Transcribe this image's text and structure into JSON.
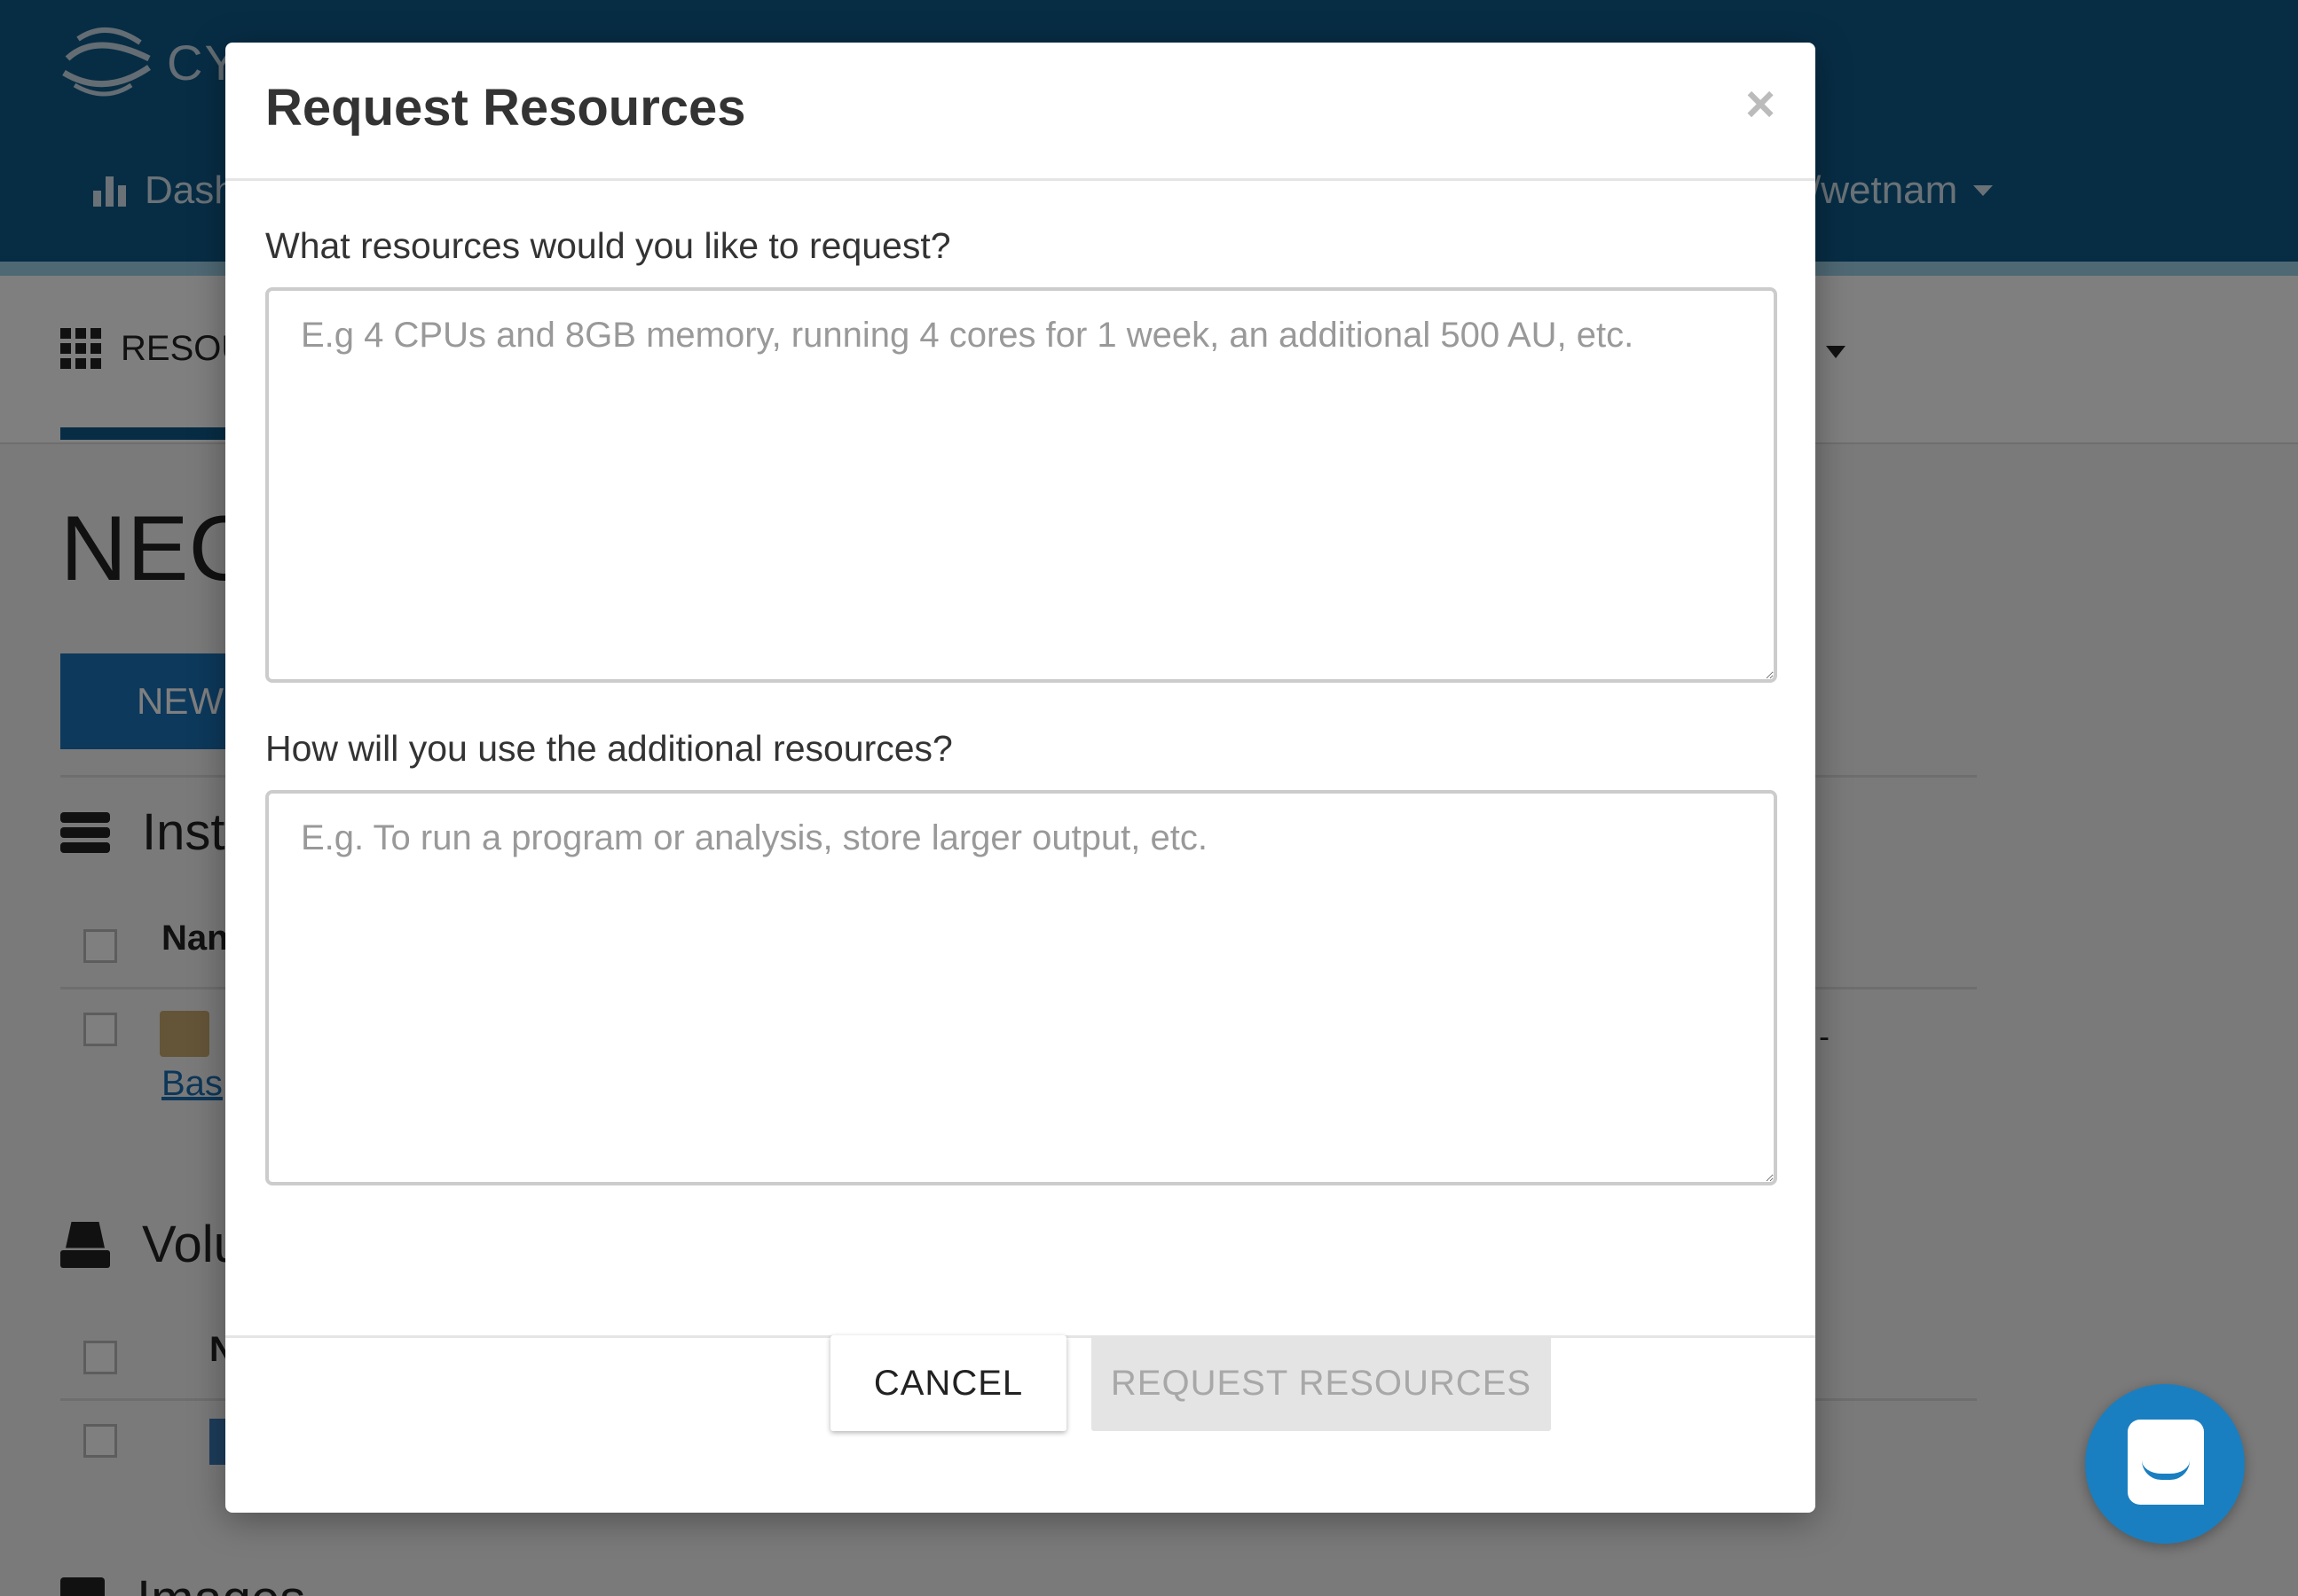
{
  "app": {
    "logo_text": "CY",
    "nav_dashboard": "Dash",
    "user_menu": "/wetnam",
    "subnav_label": "RESOU",
    "project_title": "NEC",
    "new_button": "NEW",
    "sections": {
      "instances": "Insta",
      "volumes": "Volu",
      "images": "Images"
    },
    "instances_name_header": "Nan",
    "instance_link": "Bas",
    "instance_trailing": "d -",
    "volumes_name_header": "N"
  },
  "modal": {
    "title": "Request Resources",
    "close_label": "×",
    "question_resources": "What resources would you like to request?",
    "resources_placeholder": "E.g 4 CPUs and 8GB memory, running 4 cores for 1 week, an additional 500 AU, etc.",
    "question_usage": "How will you use the additional resources?",
    "usage_placeholder": "E.g. To run a program or analysis, store larger output, etc.",
    "cancel_label": "CANCEL",
    "submit_label": "REQUEST RESOURCES"
  },
  "icons": {
    "logo": "cyverse-swirl-icon",
    "dashboard": "bar-chart-icon",
    "resources": "grid-icon",
    "instances": "server-stack-icon",
    "volumes": "hard-drive-icon",
    "images": "floppy-disk-icon",
    "chat": "chat-bubble-icon"
  },
  "colors": {
    "header_blue": "#0e5a8a",
    "accent_blue": "#1a73b8",
    "chat_blue": "#1a7fc0",
    "disabled_button": "#e4e4e4"
  }
}
